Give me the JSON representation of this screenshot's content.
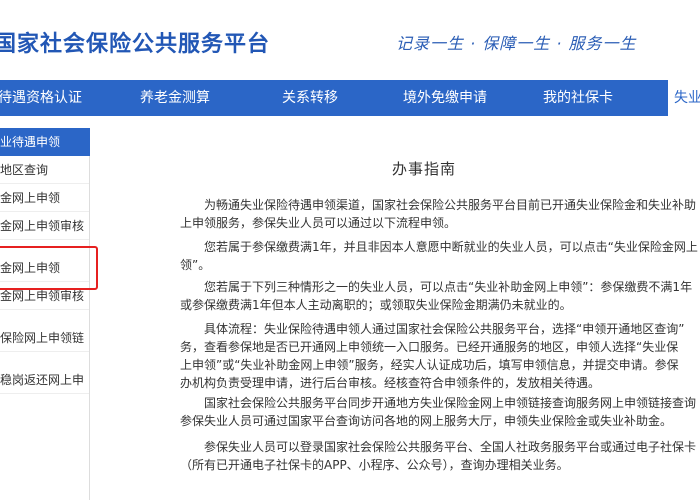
{
  "header": {
    "site_title": "国家社会保险公共服务平台",
    "slogan": "记录一生 · 保障一生 · 服务一生"
  },
  "nav": {
    "items": [
      "待遇资格认证",
      "养老金测算",
      "关系转移",
      "境外免缴申请",
      "我的社保卡",
      "失业"
    ]
  },
  "sidebar": {
    "header": "业待遇申领",
    "items": [
      "地区查询",
      "金网上申领",
      "金网上申领审核",
      "金网上申领",
      "金网上申领审核",
      "保险网上申领链",
      "稳岗返还网上申"
    ]
  },
  "content": {
    "title": "办事指南",
    "paragraphs": [
      [
        "为畅通失业保险待遇申领渠道，国家社会保险公共服务平台目前已开通失业保险金和失业补助",
        "上申领服务，参保失业人员可以通过以下流程申领。"
      ],
      [
        "您若属于参保缴费满1年，并且非因本人意愿中断就业的失业人员，可以点击“失业保险金网上",
        "领”。"
      ],
      [
        "您若属于下列三种情形之一的失业人员，可以点击“失业补助金网上申领”：参保缴费不满1年",
        "或参保缴费满1年但本人主动离职的；或领取失业保险金期满仍未就业的。"
      ],
      [
        "具体流程：失业保险待遇申领人通过国家社会保险公共服务平台，选择“申领开通地区查询”",
        "务，查看参保地是否已开通网上申领统一入口服务。已经开通服务的地区，申领人选择“失业保",
        "上申领”或“失业补助金网上申领”服务，经实人认证成功后，填写申领信息，并提交申请。参保",
        "办机构负责受理申请，进行后台审核。经核查符合申领条件的，发放相关待遇。"
      ],
      [
        "国家社会保险公共服务平台同步开通地方失业保险金网上申领链接查询服务网上申领链接查询",
        "参保失业人员可通过国家平台查询访问各地的网上服务大厅，申领失业保险金或失业补助金。"
      ],
      [
        "参保失业人员可以登录国家社会保险公共服务平台、全国人社政务服务平台或通过电子社保卡",
        "（所有已开通电子社保卡的APP、小程序、公众号），查询办理相关业务。"
      ]
    ]
  }
}
